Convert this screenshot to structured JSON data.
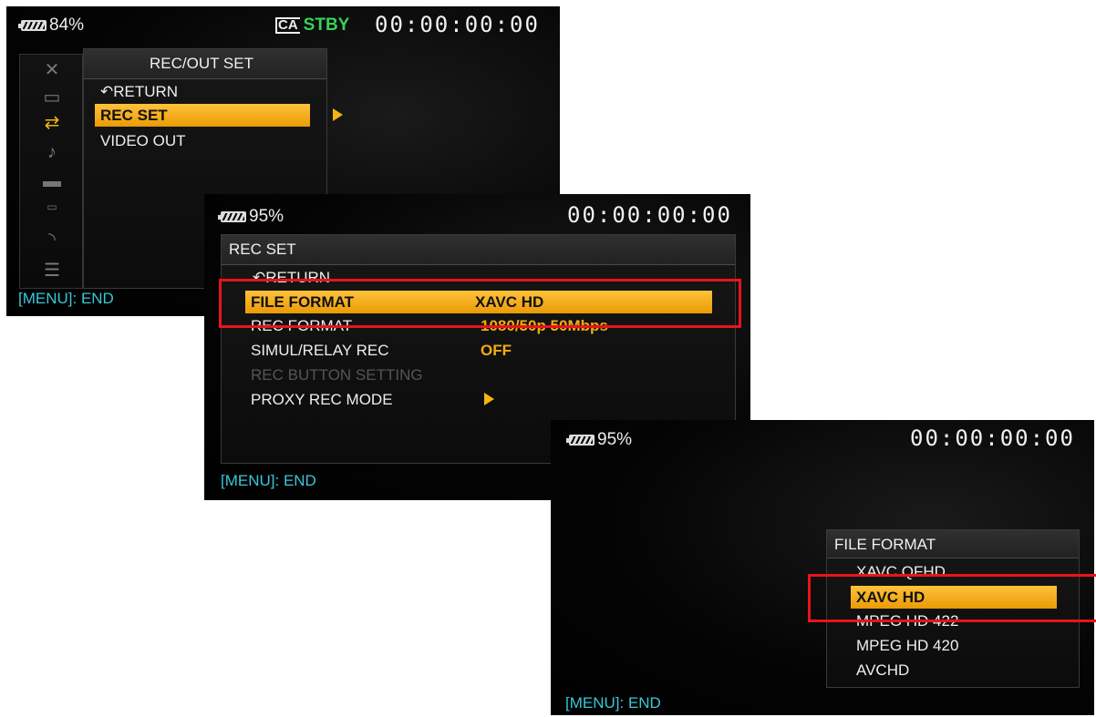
{
  "screen1": {
    "battery": "84%",
    "status": "STBY",
    "status_icon": "CA",
    "timecode": "00:00:00:00",
    "sidebar_icons": [
      "close-icon",
      "camera-icon",
      "swap-arrows-icon",
      "music-note-icon",
      "monitor-icon",
      "timecode-icon",
      "wifi-icon",
      "list-icon"
    ],
    "menu": {
      "title": "REC/OUT SET",
      "items": [
        "RETURN",
        "REC SET",
        "VIDEO OUT"
      ],
      "selected": "REC SET"
    },
    "footer": "[MENU]: END"
  },
  "screen2": {
    "battery": "95%",
    "timecode": "00:00:00:00",
    "menu": {
      "title": "REC SET",
      "items": [
        {
          "label": "RETURN",
          "value": ""
        },
        {
          "label": "FILE FORMAT",
          "value": "XAVC HD"
        },
        {
          "label": "REC FORMAT",
          "value": "1080/50p 50Mbps"
        },
        {
          "label": "SIMUL/RELAY REC",
          "value": "OFF"
        },
        {
          "label": "REC BUTTON SETTING",
          "value": ""
        },
        {
          "label": "PROXY REC MODE",
          "value": ""
        }
      ],
      "selected": "FILE FORMAT"
    },
    "footer": "[MENU]: END"
  },
  "screen3": {
    "battery": "95%",
    "timecode": "00:00:00:00",
    "menu": {
      "title": "FILE FORMAT",
      "items": [
        "XAVC QFHD",
        "XAVC HD",
        "MPEG HD 422",
        "MPEG HD 420",
        "AVCHD"
      ],
      "selected": "XAVC HD"
    },
    "footer": "[MENU]: END"
  },
  "colors": {
    "highlight": "#f5b410",
    "value_text": "#f2ad14",
    "status_green": "#35d35a",
    "footer_cyan": "#38c8d8",
    "annotation_red": "#e8141b"
  }
}
